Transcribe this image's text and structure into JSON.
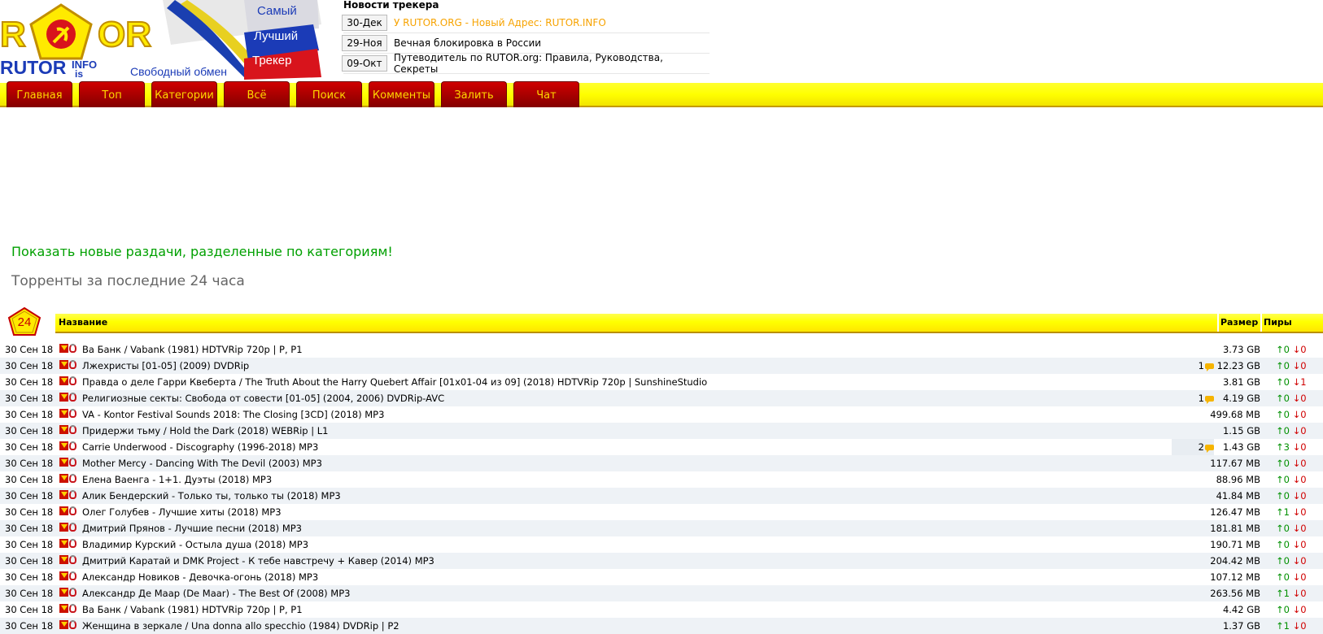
{
  "logo": {
    "site_name": "RUTOR",
    "domain": "INFO",
    "domain2": "is",
    "words": [
      "Самый",
      "Лучший",
      "Трекер"
    ],
    "tagline": "Свободный обмен"
  },
  "news": {
    "title": "Новости трекера",
    "items": [
      {
        "date": "30-Дек",
        "text": "У RUTOR.ORG - Новый Адрес: RUTOR.INFO",
        "highlight": true
      },
      {
        "date": "29-Ноя",
        "text": "Вечная блокировка в России",
        "highlight": false
      },
      {
        "date": "09-Окт",
        "text": "Путеводитель по RUTOR.org: Правила, Руководства, Секреты",
        "highlight": false
      }
    ]
  },
  "menu": [
    "Главная",
    "Топ",
    "Категории",
    "Всё",
    "Поиск",
    "Комменты",
    "Залить",
    "Чат"
  ],
  "new_link": "Показать новые раздачи, разделенные по категориям!",
  "heading": "Торренты за последние 24 часа",
  "table": {
    "badge": "24",
    "col_name": "Название",
    "col_size": "Размер",
    "col_peers": "Пиры",
    "rows": [
      {
        "date": "30 Сен 18",
        "title": "Ва Банк / Vabank (1981) HDTVRip 720p | P, P1",
        "comments": "",
        "size": "3.73 GB",
        "seeds": "0",
        "leech": "0"
      },
      {
        "date": "30 Сен 18",
        "title": "Лжехристы [01-05] (2009) DVDRip",
        "comments": "1",
        "size": "12.23 GB",
        "seeds": "0",
        "leech": "0"
      },
      {
        "date": "30 Сен 18",
        "title": "Правда о деле Гарри Квеберта / The Truth About the Harry Quebert Affair [01x01-04 из 09] (2018) HDTVRip 720p | SunshineStudio",
        "comments": "",
        "size": "3.81 GB",
        "seeds": "0",
        "leech": "1"
      },
      {
        "date": "30 Сен 18",
        "title": "Религиозные секты: Свобода от совести [01-05] (2004, 2006) DVDRip-AVC",
        "comments": "1",
        "size": "4.19 GB",
        "seeds": "0",
        "leech": "0"
      },
      {
        "date": "30 Сен 18",
        "title": "VA - Kontor Festival Sounds 2018: The Closing [3CD] (2018) MP3",
        "comments": "",
        "size": "499.68 MB",
        "seeds": "0",
        "leech": "0"
      },
      {
        "date": "30 Сен 18",
        "title": "Придержи тьму / Hold the Dark (2018) WEBRip | L1",
        "comments": "",
        "size": "1.15 GB",
        "seeds": "0",
        "leech": "0"
      },
      {
        "date": "30 Сен 18",
        "title": "Carrie Underwood - Discography (1996-2018) MP3",
        "comments": "2",
        "size": "1.43 GB",
        "seeds": "3",
        "leech": "0"
      },
      {
        "date": "30 Сен 18",
        "title": "Mother Mercy - Dancing With The Devil (2003) MP3",
        "comments": "",
        "size": "117.67 MB",
        "seeds": "0",
        "leech": "0"
      },
      {
        "date": "30 Сен 18",
        "title": "Елена Ваенга - 1+1. Дуэты (2018) MP3",
        "comments": "",
        "size": "88.96 MB",
        "seeds": "0",
        "leech": "0"
      },
      {
        "date": "30 Сен 18",
        "title": "Алик Бендерский - Только ты, только ты (2018) MP3",
        "comments": "",
        "size": "41.84 MB",
        "seeds": "0",
        "leech": "0"
      },
      {
        "date": "30 Сен 18",
        "title": "Олег Голубев - Лучшие хиты (2018) MP3",
        "comments": "",
        "size": "126.47 MB",
        "seeds": "1",
        "leech": "0"
      },
      {
        "date": "30 Сен 18",
        "title": "Дмитрий Прянов - Лучшие песни (2018) MP3",
        "comments": "",
        "size": "181.81 MB",
        "seeds": "0",
        "leech": "0"
      },
      {
        "date": "30 Сен 18",
        "title": "Владимир Курский - Остыла душа (2018) MP3",
        "comments": "",
        "size": "190.71 MB",
        "seeds": "0",
        "leech": "0"
      },
      {
        "date": "30 Сен 18",
        "title": "Дмитрий Каратай и DMK Project - К тебе навстречу + Кавер (2014) MP3",
        "comments": "",
        "size": "204.42 MB",
        "seeds": "0",
        "leech": "0"
      },
      {
        "date": "30 Сен 18",
        "title": "Александр Новиков - Девочка-огонь (2018) MP3",
        "comments": "",
        "size": "107.12 MB",
        "seeds": "0",
        "leech": "0"
      },
      {
        "date": "30 Сен 18",
        "title": "Александр Де Маар (De Maar) - The Best Of (2008) MP3",
        "comments": "",
        "size": "263.56 MB",
        "seeds": "1",
        "leech": "0"
      },
      {
        "date": "30 Сен 18",
        "title": "Ва Банк / Vabank (1981) HDTVRip 720p | P, P1",
        "comments": "",
        "size": "4.42 GB",
        "seeds": "0",
        "leech": "0"
      },
      {
        "date": "30 Сен 18",
        "title": "Женщина в зеркале / Una donna allo specchio (1984) DVDRip | P2",
        "comments": "",
        "size": "1.37 GB",
        "seeds": "1",
        "leech": "0"
      }
    ]
  },
  "colors": {
    "menu_tab": "#b00000",
    "menu_text": "#ffd800",
    "bar_yellow": "#ffff00",
    "link_green": "#00a000",
    "highlight_news": "#f7a300",
    "seed_green": "#009000",
    "leech_red": "#d00000"
  }
}
